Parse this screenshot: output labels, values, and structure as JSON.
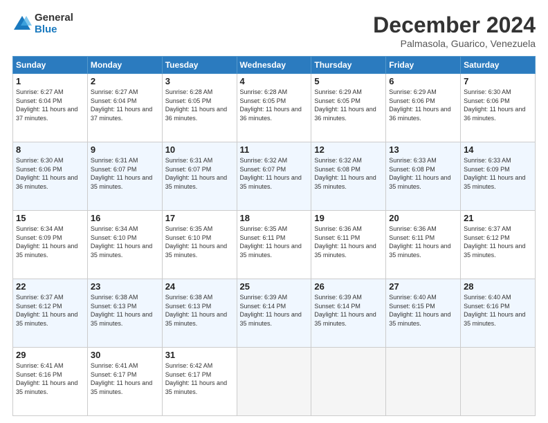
{
  "logo": {
    "general": "General",
    "blue": "Blue"
  },
  "header": {
    "month": "December 2024",
    "location": "Palmasola, Guarico, Venezuela"
  },
  "weekdays": [
    "Sunday",
    "Monday",
    "Tuesday",
    "Wednesday",
    "Thursday",
    "Friday",
    "Saturday"
  ],
  "weeks": [
    [
      {
        "day": "1",
        "sunrise": "6:27 AM",
        "sunset": "6:04 PM",
        "daylight": "11 hours and 37 minutes."
      },
      {
        "day": "2",
        "sunrise": "6:27 AM",
        "sunset": "6:04 PM",
        "daylight": "11 hours and 37 minutes."
      },
      {
        "day": "3",
        "sunrise": "6:28 AM",
        "sunset": "6:05 PM",
        "daylight": "11 hours and 36 minutes."
      },
      {
        "day": "4",
        "sunrise": "6:28 AM",
        "sunset": "6:05 PM",
        "daylight": "11 hours and 36 minutes."
      },
      {
        "day": "5",
        "sunrise": "6:29 AM",
        "sunset": "6:05 PM",
        "daylight": "11 hours and 36 minutes."
      },
      {
        "day": "6",
        "sunrise": "6:29 AM",
        "sunset": "6:06 PM",
        "daylight": "11 hours and 36 minutes."
      },
      {
        "day": "7",
        "sunrise": "6:30 AM",
        "sunset": "6:06 PM",
        "daylight": "11 hours and 36 minutes."
      }
    ],
    [
      {
        "day": "8",
        "sunrise": "6:30 AM",
        "sunset": "6:06 PM",
        "daylight": "11 hours and 36 minutes."
      },
      {
        "day": "9",
        "sunrise": "6:31 AM",
        "sunset": "6:07 PM",
        "daylight": "11 hours and 35 minutes."
      },
      {
        "day": "10",
        "sunrise": "6:31 AM",
        "sunset": "6:07 PM",
        "daylight": "11 hours and 35 minutes."
      },
      {
        "day": "11",
        "sunrise": "6:32 AM",
        "sunset": "6:07 PM",
        "daylight": "11 hours and 35 minutes."
      },
      {
        "day": "12",
        "sunrise": "6:32 AM",
        "sunset": "6:08 PM",
        "daylight": "11 hours and 35 minutes."
      },
      {
        "day": "13",
        "sunrise": "6:33 AM",
        "sunset": "6:08 PM",
        "daylight": "11 hours and 35 minutes."
      },
      {
        "day": "14",
        "sunrise": "6:33 AM",
        "sunset": "6:09 PM",
        "daylight": "11 hours and 35 minutes."
      }
    ],
    [
      {
        "day": "15",
        "sunrise": "6:34 AM",
        "sunset": "6:09 PM",
        "daylight": "11 hours and 35 minutes."
      },
      {
        "day": "16",
        "sunrise": "6:34 AM",
        "sunset": "6:10 PM",
        "daylight": "11 hours and 35 minutes."
      },
      {
        "day": "17",
        "sunrise": "6:35 AM",
        "sunset": "6:10 PM",
        "daylight": "11 hours and 35 minutes."
      },
      {
        "day": "18",
        "sunrise": "6:35 AM",
        "sunset": "6:11 PM",
        "daylight": "11 hours and 35 minutes."
      },
      {
        "day": "19",
        "sunrise": "6:36 AM",
        "sunset": "6:11 PM",
        "daylight": "11 hours and 35 minutes."
      },
      {
        "day": "20",
        "sunrise": "6:36 AM",
        "sunset": "6:11 PM",
        "daylight": "11 hours and 35 minutes."
      },
      {
        "day": "21",
        "sunrise": "6:37 AM",
        "sunset": "6:12 PM",
        "daylight": "11 hours and 35 minutes."
      }
    ],
    [
      {
        "day": "22",
        "sunrise": "6:37 AM",
        "sunset": "6:12 PM",
        "daylight": "11 hours and 35 minutes."
      },
      {
        "day": "23",
        "sunrise": "6:38 AM",
        "sunset": "6:13 PM",
        "daylight": "11 hours and 35 minutes."
      },
      {
        "day": "24",
        "sunrise": "6:38 AM",
        "sunset": "6:13 PM",
        "daylight": "11 hours and 35 minutes."
      },
      {
        "day": "25",
        "sunrise": "6:39 AM",
        "sunset": "6:14 PM",
        "daylight": "11 hours and 35 minutes."
      },
      {
        "day": "26",
        "sunrise": "6:39 AM",
        "sunset": "6:14 PM",
        "daylight": "11 hours and 35 minutes."
      },
      {
        "day": "27",
        "sunrise": "6:40 AM",
        "sunset": "6:15 PM",
        "daylight": "11 hours and 35 minutes."
      },
      {
        "day": "28",
        "sunrise": "6:40 AM",
        "sunset": "6:16 PM",
        "daylight": "11 hours and 35 minutes."
      }
    ],
    [
      {
        "day": "29",
        "sunrise": "6:41 AM",
        "sunset": "6:16 PM",
        "daylight": "11 hours and 35 minutes."
      },
      {
        "day": "30",
        "sunrise": "6:41 AM",
        "sunset": "6:17 PM",
        "daylight": "11 hours and 35 minutes."
      },
      {
        "day": "31",
        "sunrise": "6:42 AM",
        "sunset": "6:17 PM",
        "daylight": "11 hours and 35 minutes."
      },
      null,
      null,
      null,
      null
    ]
  ]
}
